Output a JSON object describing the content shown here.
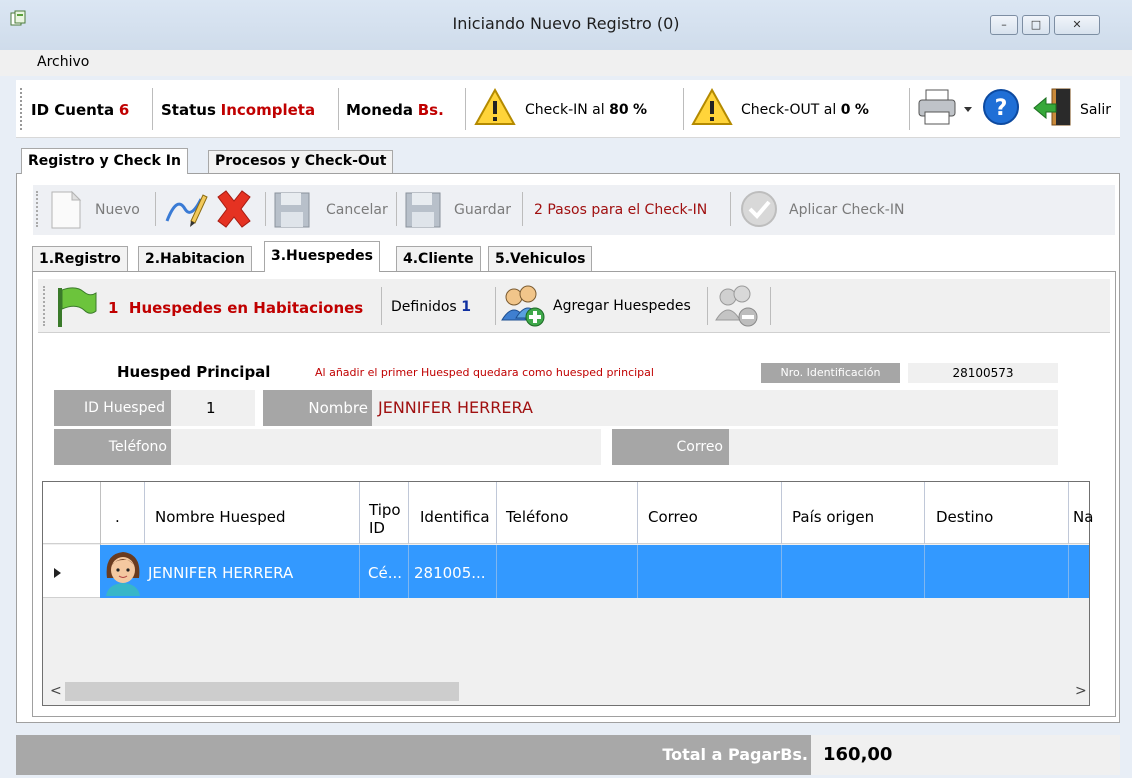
{
  "window": {
    "title": "Iniciando Nuevo Registro (0)",
    "controls": [
      "–",
      "□",
      "✕"
    ]
  },
  "menu": {
    "archivo": "Archivo"
  },
  "status": {
    "id_cuenta_label": "ID Cuenta",
    "id_cuenta_value": "6",
    "status_label": "Status",
    "status_value": "Incompleta",
    "moneda_label": "Moneda",
    "moneda_value": "Bs.",
    "checkin_label": "Check-IN al",
    "checkin_value": "80",
    "checkin_unit": "%",
    "checkout_label": "Check-OUT al",
    "checkout_value": "0",
    "checkout_unit": "%",
    "salir_label": "Salir"
  },
  "main_tabs": [
    "Registro y Check In",
    "Procesos y Check-Out"
  ],
  "toolbar": {
    "nuevo": "Nuevo",
    "cancelar": "Cancelar",
    "guardar": "Guardar",
    "pasos": "2 Pasos para el Check-IN",
    "aplicar": "Aplicar Check-IN"
  },
  "sub_tabs": [
    "1.Registro",
    "2.Habitacion",
    "3.Huespedes",
    "4.Cliente",
    "5.Vehiculos"
  ],
  "huespedes_bar": {
    "count": "1",
    "count_label": "Huespedes en Habitaciones",
    "definidos_label": "Definidos",
    "definidos_value": "1",
    "agregar": "Agregar Huespedes"
  },
  "form": {
    "principal_title": "Huesped Principal",
    "principal_note": "Al añadir el primer Huesped quedara como huesped principal",
    "nro_id_label": "Nro. Identificación",
    "nro_id_value": "28100573",
    "id_huesped_label": "ID Huesped",
    "id_huesped_value": "1",
    "nombre_label": "Nombre",
    "nombre_value": "JENNIFER HERRERA",
    "telefono_label": "Teléfono",
    "telefono_value": "",
    "correo_label": "Correo",
    "correo_value": ""
  },
  "grid": {
    "headers": [
      ".",
      "Nombre Huesped",
      "Tipo ID",
      "Identifica",
      "Teléfono",
      "Correo",
      "País origen",
      "Destino",
      "Na"
    ],
    "rows": [
      {
        "nombre": "JENNIFER HERRERA",
        "tipo": "Cé...",
        "ident": "281005...",
        "telefono": "",
        "correo": "",
        "pais": "",
        "destino": ""
      }
    ]
  },
  "total": {
    "label": "Total a PagarBs.",
    "value": "160,00"
  },
  "colors": {
    "selected_row": "#3399ff",
    "accent_red": "#c00000",
    "accent_blue": "#1030a0"
  }
}
